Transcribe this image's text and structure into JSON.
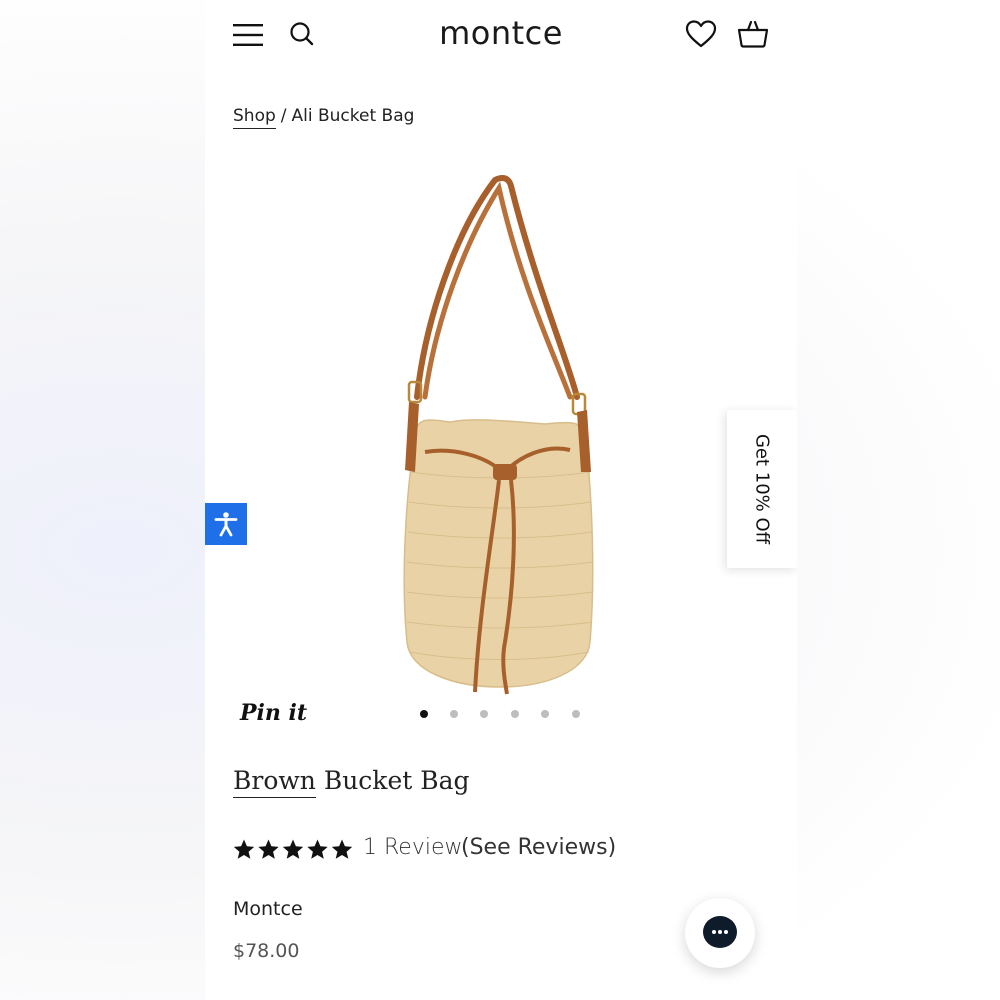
{
  "header": {
    "logo": "montce",
    "icons": [
      "menu-icon",
      "search-icon",
      "heart-icon",
      "basket-icon"
    ]
  },
  "breadcrumb": {
    "shop": "Shop",
    "separator": "/",
    "current": "Ali Bucket Bag"
  },
  "gallery": {
    "pin_label": "Pin it",
    "slide_count": 6,
    "active_slide": 1
  },
  "promo": {
    "label": "Get 10% Off"
  },
  "product": {
    "title_first": "Brown",
    "title_rest": " Bucket Bag",
    "rating": 5,
    "review_count": "1 Review",
    "see_reviews": "(See Reviews)",
    "vendor": "Montce",
    "price": "$78.00"
  },
  "colors": {
    "accessibility_blue": "#1e6fe8",
    "chat_navy": "#0d1b2a",
    "bag_straw": "#e9d3a6",
    "bag_leather": "#a7602c"
  }
}
